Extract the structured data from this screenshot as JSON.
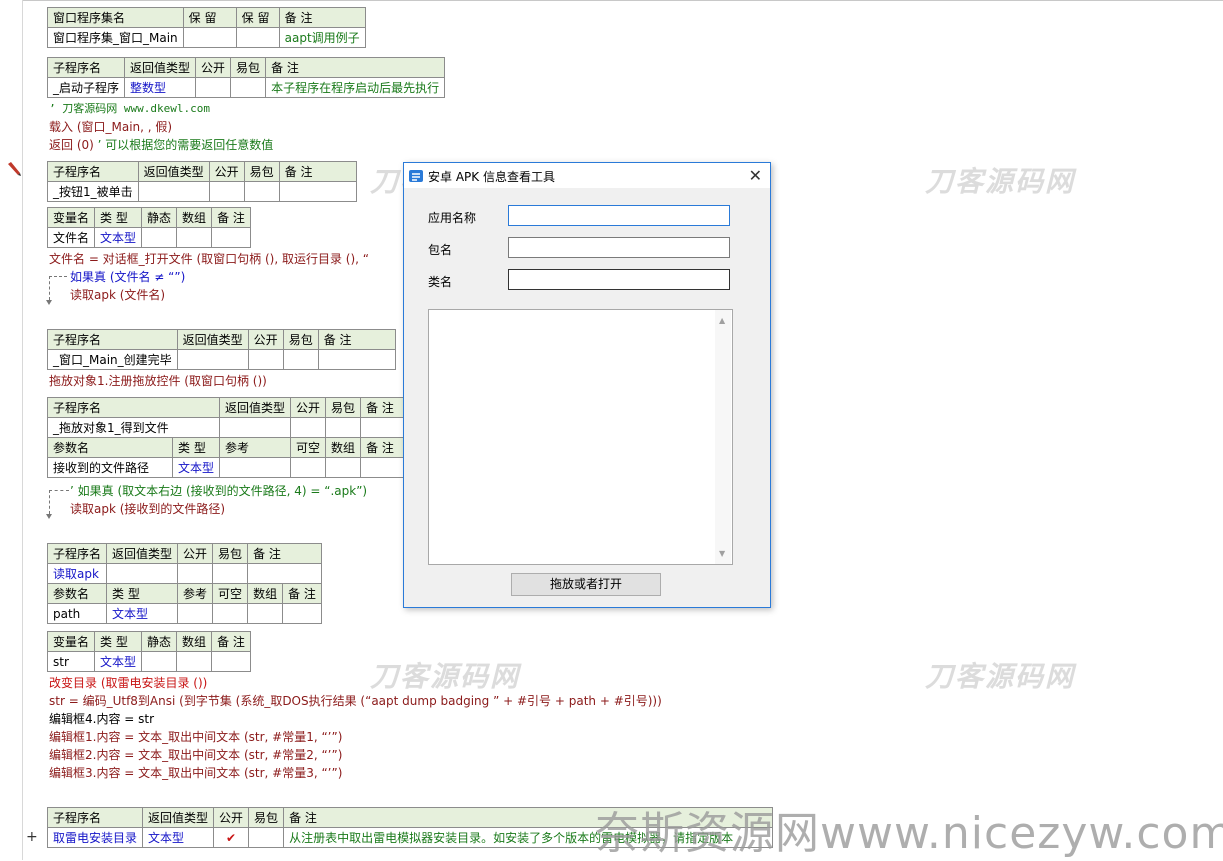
{
  "window_set": {
    "headers": [
      "窗口程序集名",
      "保 留",
      "保 留",
      "备 注"
    ],
    "row": [
      "窗口程序集_窗口_Main",
      "",
      "",
      "aapt调用例子"
    ]
  },
  "sub_headers": [
    "子程序名",
    "返回值类型",
    "公开",
    "易包",
    "备 注"
  ],
  "var_headers": [
    "变量名",
    "类 型",
    "静态",
    "数组",
    "备 注"
  ],
  "param_headers": [
    "参数名",
    "类 型",
    "参考",
    "可空",
    "数组",
    "备 注"
  ],
  "sub1": {
    "name": "_启动子程序",
    "ret": "整数型",
    "note": "本子程序在程序启动后最先执行"
  },
  "code1": {
    "l1": "’ 刀客源码网 www.dkewl.com",
    "l2": "载入 (窗口_Main, , 假)",
    "l3a": "返回 (0)",
    "l3b": "’ 可以根据您的需要返回任意数值"
  },
  "sub2": {
    "name": "_按钮1_被单击"
  },
  "var2": {
    "name": "文件名",
    "type": "文本型"
  },
  "code2": {
    "l1": "文件名 = 对话框_打开文件 (取窗口句柄 (), 取运行目录 (), “",
    "l2": "如果真 (文件名 ≠ “”)",
    "l3": "读取apk (文件名)"
  },
  "sub3": {
    "name": "_窗口_Main_创建完毕"
  },
  "code3": {
    "l1": "拖放对象1.注册拖放控件 (取窗口句柄 ())"
  },
  "sub4": {
    "name": "_拖放对象1_得到文件"
  },
  "param4": {
    "name": "接收到的文件路径",
    "type": "文本型"
  },
  "code4": {
    "l1": "’ 如果真 (取文本右边 (接收到的文件路径, 4) = “.apk”)",
    "l2": "读取apk (接收到的文件路径)"
  },
  "sub5": {
    "name": "读取apk"
  },
  "param5": {
    "name": "path",
    "type": "文本型"
  },
  "var5": {
    "name": "str",
    "type": "文本型"
  },
  "code5": {
    "l1": "改变目录 (取雷电安装目录 ())",
    "l2": "str = 编码_Utf8到Ansi (到字节集 (系统_取DOS执行结果 (“aapt dump badging ” + #引号 + path + #引号)))",
    "l3": "编辑框4.内容 = str",
    "l4": "编辑框1.内容 = 文本_取出中间文本 (str, #常量1, “’”)",
    "l5": "编辑框2.内容 = 文本_取出中间文本 (str, #常量2, “’”)",
    "l6": "编辑框3.内容 = 文本_取出中间文本 (str, #常量3, “’”)"
  },
  "sub6": {
    "name": "取雷电安装目录",
    "ret": "文本型",
    "public": "✔",
    "note": "从注册表中取出雷电模拟器安装目录。如安装了多个版本的雷电模拟器，请指定版本"
  },
  "dialog": {
    "title": "安卓 APK 信息查看工具",
    "close": "✕",
    "label_app": "应用名称",
    "label_pkg": "包名",
    "label_class": "类名",
    "app_value": "",
    "pkg_value": "",
    "class_value": "",
    "memo_value": "",
    "button": "拖放或者打开"
  },
  "watermark": {
    "text": "刀客源码网",
    "site": "奈斯资源网www.nicezyw.com"
  },
  "colors": {
    "header_bg": "#e6f0dc",
    "type_blue": "#1515c8",
    "note_green": "#1a7a1a",
    "accent": "#2a7ad8"
  }
}
